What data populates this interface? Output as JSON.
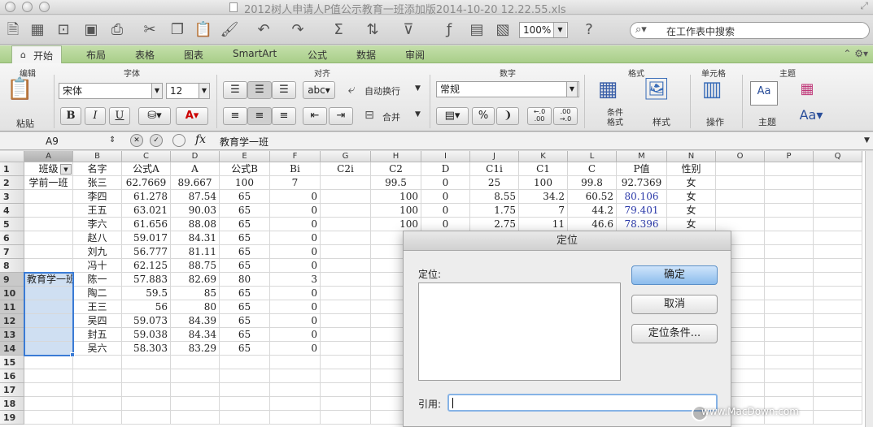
{
  "window": {
    "title": "2012树人申请人P值公示教育一班添加版2014-10-20 12.22.55.xls"
  },
  "toolbar": {
    "zoom": "100%",
    "search_placeholder": "在工作表中搜索"
  },
  "ribbon_tabs": [
    "开始",
    "布局",
    "表格",
    "图表",
    "SmartArt",
    "公式",
    "数据",
    "审阅"
  ],
  "ribbon": {
    "groups": {
      "edit": "编辑",
      "font": "字体",
      "align": "对齐",
      "number": "数字",
      "format": "格式",
      "cells": "单元格",
      "theme": "主题"
    },
    "paste_label": "粘贴",
    "font_name": "宋体",
    "font_size": "12",
    "bold": "B",
    "italic": "I",
    "underline": "U",
    "wrap_label": "自动换行",
    "merge_label": "合并",
    "number_format": "常规",
    "percent": "%",
    "cond_format_label": "条件格式",
    "style_label": "样式",
    "ops_label": "操作",
    "theme_label": "主题",
    "abc_label": "abc",
    "decimal_inc": "←.0 .00",
    "decimal_dec": ".00 →.0"
  },
  "formula_bar": {
    "cell_ref": "A9",
    "fx": "fx",
    "content": "教育学一班"
  },
  "sheet": {
    "columns": [
      "A",
      "B",
      "C",
      "D",
      "E",
      "F",
      "G",
      "H",
      "I",
      "J",
      "K",
      "L",
      "M",
      "N",
      "O",
      "P",
      "Q"
    ],
    "rows": [
      [
        "班级",
        "名字",
        "公式A",
        "A",
        "公式B",
        "Bi",
        "C2i",
        "C2",
        "D",
        "C1i",
        "C1",
        "C",
        "P值",
        "性别"
      ],
      [
        "学前一班",
        "张三",
        "62.7669",
        "89.667",
        "100",
        "7",
        "",
        "99.5",
        "0",
        "25",
        "100",
        "99.8",
        "92.7369",
        "女"
      ],
      [
        "",
        "李四",
        "61.278",
        "87.54",
        "65",
        "0",
        "",
        "100",
        "0",
        "8.55",
        "34.2",
        "60.52",
        "80.106",
        "女"
      ],
      [
        "",
        "王五",
        "63.021",
        "90.03",
        "65",
        "0",
        "",
        "100",
        "0",
        "1.75",
        "7",
        "44.2",
        "79.401",
        "女"
      ],
      [
        "",
        "李六",
        "61.656",
        "88.08",
        "65",
        "0",
        "",
        "100",
        "0",
        "2.75",
        "11",
        "46.6",
        "78.396",
        "女"
      ],
      [
        "",
        "赵八",
        "59.017",
        "84.31",
        "65",
        "0",
        "",
        "",
        "",
        "",
        "",
        "",
        "",
        ""
      ],
      [
        "",
        "刘九",
        "56.777",
        "81.11",
        "65",
        "0",
        "",
        "",
        "",
        "",
        "",
        "",
        "",
        ""
      ],
      [
        "",
        "冯十",
        "62.125",
        "88.75",
        "65",
        "0",
        "",
        "",
        "",
        "",
        "",
        "",
        "",
        ""
      ],
      [
        "教育学一班",
        "陈一",
        "57.883",
        "82.69",
        "80",
        "3",
        "",
        "",
        "",
        "",
        "",
        "",
        "",
        ""
      ],
      [
        "",
        "陶二",
        "59.5",
        "85",
        "65",
        "0",
        "",
        "",
        "",
        "",
        "",
        "",
        "",
        ""
      ],
      [
        "",
        "王三",
        "56",
        "80",
        "65",
        "0",
        "",
        "",
        "",
        "",
        "",
        "",
        "",
        ""
      ],
      [
        "",
        "吴四",
        "59.073",
        "84.39",
        "65",
        "0",
        "",
        "",
        "",
        "",
        "",
        "",
        "",
        ""
      ],
      [
        "",
        "封五",
        "59.038",
        "84.34",
        "65",
        "0",
        "",
        "",
        "",
        "",
        "",
        "",
        "",
        ""
      ],
      [
        "",
        "吴六",
        "58.303",
        "83.29",
        "65",
        "0",
        "",
        "",
        "",
        "",
        "",
        "",
        "",
        ""
      ]
    ],
    "row_numbers": [
      "1",
      "2",
      "3",
      "4",
      "5",
      "6",
      "7",
      "8",
      "9",
      "10",
      "11",
      "12",
      "13",
      "14",
      "15",
      "16",
      "17",
      "18",
      "19"
    ]
  },
  "dialog": {
    "title": "定位",
    "goto_label": "定位:",
    "reference_label": "引用:",
    "reference_value": "",
    "ok_button": "确定",
    "cancel_button": "取消",
    "special_button": "定位条件..."
  },
  "watermark": "www.MacDown.com"
}
